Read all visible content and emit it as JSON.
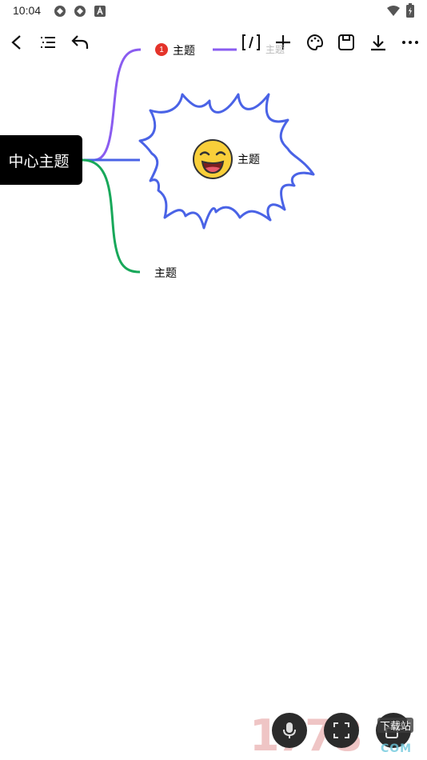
{
  "status": {
    "time": "10:04",
    "icons": [
      "sync-icon",
      "sync-icon",
      "a-icon",
      "wifi-icon",
      "battery-icon"
    ]
  },
  "toolbar": {
    "buttons": [
      "back-icon",
      "outline-icon",
      "undo-icon",
      "summary-bracket-icon",
      "add-icon",
      "palette-icon",
      "save-icon",
      "download-icon",
      "more-icon"
    ]
  },
  "mindmap": {
    "center": "中心主题",
    "badge": "1",
    "topic1": "主题",
    "topic1_child_hint": "主题",
    "topic2": "主题",
    "topic3": "主题"
  },
  "colors": {
    "branch1": "#8a5cf0",
    "branch2": "#4a63e6",
    "branch3": "#18a85a",
    "burst": "#4a63e6",
    "badge": "#e4332a"
  },
  "watermark": {
    "digits": "1778",
    "sub": "下载站",
    "com": "COM"
  }
}
